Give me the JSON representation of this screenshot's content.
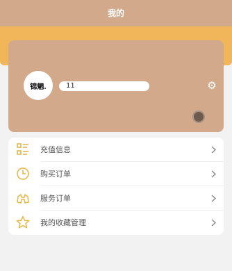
{
  "header": {
    "title": "我的"
  },
  "profile": {
    "avatar_text": "锦魍.",
    "name": "11",
    "settings_icon": "gear-icon"
  },
  "menu": {
    "items": [
      {
        "label": "充值信息",
        "icon": "list-icon"
      },
      {
        "label": "购买订单",
        "icon": "clock-icon"
      },
      {
        "label": "服务订单",
        "icon": "binoculars-icon"
      },
      {
        "label": "我的收藏管理",
        "icon": "star-icon"
      }
    ]
  },
  "colors": {
    "header_bg": "#d2a98a",
    "accent_band": "#f2b65a",
    "icon_accent": "#e8b64a",
    "page_bg": "#f2f2f2"
  }
}
